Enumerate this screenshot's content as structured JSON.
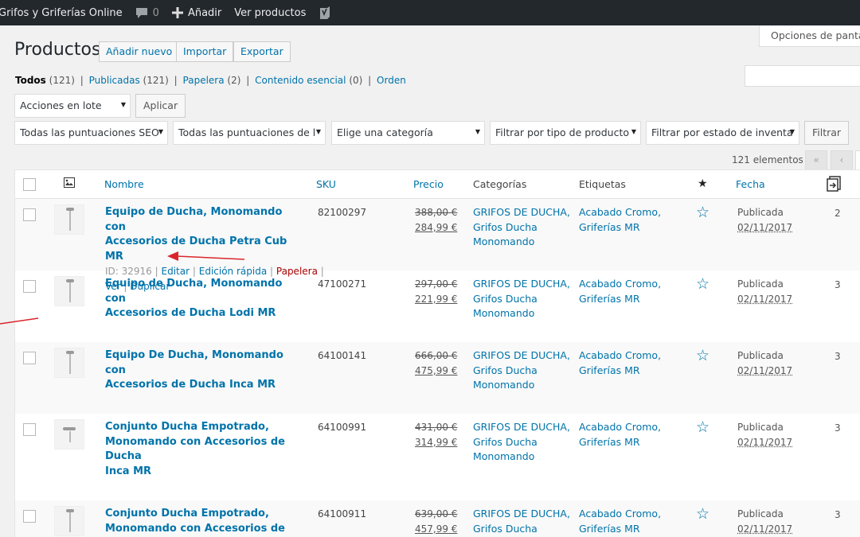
{
  "adminbar": {
    "site_name": "Grifos y Griferías Online",
    "comments_count": "0",
    "add_label": "Añadir",
    "view_products": "Ver productos"
  },
  "screen_options": "Opciones de pantalla",
  "header": {
    "title": "Productos",
    "add_new": "Añadir nuevo",
    "import": "Importar",
    "export": "Exportar"
  },
  "views": {
    "all": "Todos",
    "all_count": "(121)",
    "published": "Publicadas",
    "published_count": "(121)",
    "trash": "Papelera",
    "trash_count": "(2)",
    "essential": "Contenido esencial",
    "essential_count": "(0)",
    "order": "Orden",
    "separator": "|"
  },
  "bulk": {
    "select": "Acciones en lote",
    "apply": "Aplicar"
  },
  "filters": {
    "seo_score": "Todas las puntuaciones SEO",
    "readability": "Todas las puntuaciones de l",
    "category": "Elige una categoría",
    "product_type": "Filtrar por tipo de producto",
    "stock_status": "Filtrar por estado de inventa",
    "filter_btn": "Filtrar"
  },
  "pagination": {
    "items": "121 elementos",
    "first": "«",
    "prev": "‹"
  },
  "columns": {
    "name": "Nombre",
    "sku": "SKU",
    "price": "Precio",
    "categories": "Categorías",
    "tags": "Etiquetas",
    "date": "Fecha"
  },
  "row_actions": {
    "id": "ID: 32916",
    "edit": "Editar",
    "quick_edit": "Edición rápida",
    "trash": "Papelera",
    "view": "Ver",
    "duplicate": "Duplicar",
    "sep": "|"
  },
  "rows": [
    {
      "name1": "Equipo de Ducha, Monomando con",
      "name2": "Accesorios de Ducha Petra Cub MR",
      "name3": "",
      "sku": "82100297",
      "old_price": "388,00 €",
      "new_price": "284,99 €",
      "cat1": "GRIFOS DE DUCHA,",
      "cat2": "Grifos Ducha",
      "cat3": "Monomando",
      "tag1": "Acabado Cromo,",
      "tag2": "Griferías MR",
      "status": "Publicada",
      "date": "02/11/2017",
      "num": "2"
    },
    {
      "name1": "Equipo de Ducha, Monomando con",
      "name2": "Accesorios de Ducha Lodi MR",
      "name3": "",
      "sku": "47100271",
      "old_price": "297,00 €",
      "new_price": "221,99 €",
      "cat1": "GRIFOS DE DUCHA,",
      "cat2": "Grifos Ducha",
      "cat3": "Monomando",
      "tag1": "Acabado Cromo,",
      "tag2": "Griferías MR",
      "status": "Publicada",
      "date": "02/11/2017",
      "num": "3"
    },
    {
      "name1": "Equipo De Ducha, Monomando con",
      "name2": "Accesorios de Ducha Inca MR",
      "name3": "",
      "sku": "64100141",
      "old_price": "666,00 €",
      "new_price": "475,99 €",
      "cat1": "GRIFOS DE DUCHA,",
      "cat2": "Grifos Ducha",
      "cat3": "Monomando",
      "tag1": "Acabado Cromo,",
      "tag2": "Griferías MR",
      "status": "Publicada",
      "date": "02/11/2017",
      "num": "3"
    },
    {
      "name1": "Conjunto Ducha Empotrado,",
      "name2": "Monomando con Accesorios de Ducha",
      "name3": "Inca MR",
      "sku": "64100991",
      "old_price": "431,00 €",
      "new_price": "314,99 €",
      "cat1": "GRIFOS DE DUCHA,",
      "cat2": "Grifos Ducha",
      "cat3": "Monomando",
      "tag1": "Acabado Cromo,",
      "tag2": "Griferías MR",
      "status": "Publicada",
      "date": "02/11/2017",
      "num": "3"
    },
    {
      "name1": "Conjunto Ducha Empotrado,",
      "name2": "Monomando con Accesorios de Ducha",
      "name3": "",
      "sku": "64100911",
      "old_price": "639,00 €",
      "new_price": "457,99 €",
      "cat1": "GRIFOS DE DUCHA,",
      "cat2": "Grifos Ducha",
      "cat3": "",
      "tag1": "Acabado Cromo,",
      "tag2": "Griferías MR",
      "status": "Publicada",
      "date": "02/11/2017",
      "num": "3"
    }
  ],
  "colors": {
    "link": "#0073aa",
    "adminbar": "#23282d",
    "arrow": "#d9262c"
  }
}
